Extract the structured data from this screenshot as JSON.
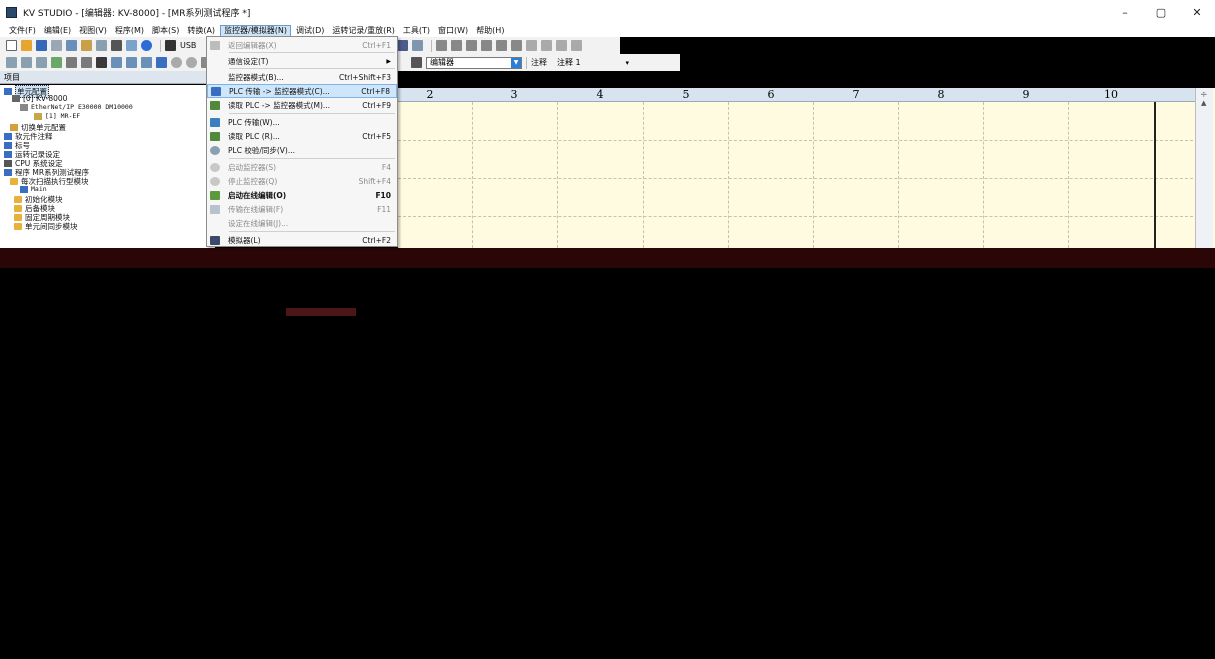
{
  "window": {
    "title": "KV STUDIO - [编辑器: KV-8000] - [MR系列测试程序 *]",
    "controls": [
      "–",
      "▢",
      "✕"
    ]
  },
  "menubar": {
    "items": [
      "文件(F)",
      "编辑(E)",
      "视图(V)",
      "程序(M)",
      "脚本(S)",
      "转换(A)",
      "监控器/模拟器(N)",
      "调试(D)",
      "运转记录/重放(R)",
      "工具(T)",
      "窗口(W)",
      "帮助(H)"
    ],
    "active_index": 6
  },
  "toolbar": {
    "usb_label": "USB",
    "editor_combo": "编辑器",
    "comment_label": "注释",
    "comment_combo": "注释 1"
  },
  "project_panel": {
    "header": "项目",
    "items": [
      "单元配置",
      "[0]  KV-8000",
      "EtherNet/IP  E30000  DM10000",
      "[1]  MR-EF",
      "切换单元配置",
      "软元件注释",
      "标号",
      "运转记录设定",
      "CPU 系统设定",
      "程序  MR系列测试程序",
      "每次扫描执行型模块",
      "Main",
      "初始化模块",
      "后备模块",
      "固定周期模块",
      "单元间同步模块"
    ]
  },
  "ruler": {
    "columns": [
      "2",
      "3",
      "4",
      "5",
      "6",
      "7",
      "8",
      "9",
      "10"
    ]
  },
  "dropdown_menu": {
    "items": [
      {
        "label": "返回编辑器(X)",
        "shortcut": "Ctrl+F1",
        "disabled": true
      },
      {
        "label": "通信设定(T)",
        "shortcut": "",
        "submenu": true
      },
      {
        "label": "监控器模式(B)...",
        "shortcut": "Ctrl+Shift+F3"
      },
      {
        "label": "PLC 传输 -> 监控器模式(C)...",
        "shortcut": "Ctrl+F8",
        "highlight": true
      },
      {
        "label": "读取 PLC -> 监控器模式(M)...",
        "shortcut": "Ctrl+F9"
      },
      {
        "label": "PLC 传输(W)...",
        "shortcut": ""
      },
      {
        "label": "读取 PLC (R)...",
        "shortcut": "Ctrl+F5"
      },
      {
        "label": "PLC 校验/同步(V)...",
        "shortcut": ""
      },
      {
        "label": "启动监控器(S)",
        "shortcut": "F4",
        "disabled": true
      },
      {
        "label": "停止监控器(Q)",
        "shortcut": "Shift+F4",
        "disabled": true
      },
      {
        "label": "启动在线编辑(O)",
        "shortcut": "F10",
        "bold": true
      },
      {
        "label": "传输在线编辑(F)",
        "shortcut": "F11",
        "disabled": true
      },
      {
        "label": "设定在线编辑(J)...",
        "shortcut": "",
        "disabled": true
      },
      {
        "label": "模拟器(L)",
        "shortcut": "Ctrl+F2"
      }
    ]
  },
  "colors": {
    "editor_bg": "#fffbe0",
    "ruler_bg": "#d7e4f0",
    "menu_highlight": "#cde6fb"
  }
}
